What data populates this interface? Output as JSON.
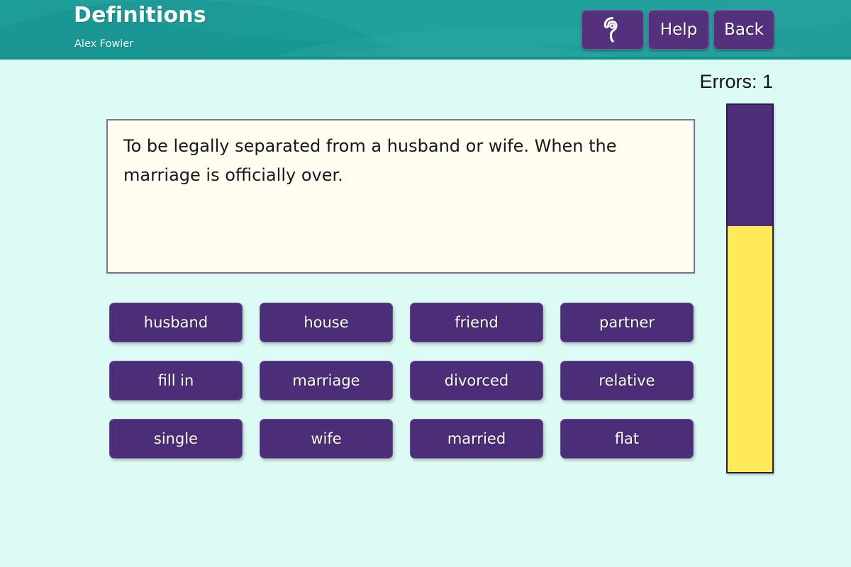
{
  "header": {
    "title": "Definitions",
    "subtitle": "Alex Fowler",
    "buttons": {
      "listen": {
        "icon": "ear-icon",
        "label": ""
      },
      "help": {
        "label": "Help"
      },
      "back": {
        "label": "Back"
      }
    },
    "background_color": "#1d9b97"
  },
  "status": {
    "errors_label": "Errors: 1"
  },
  "progress": {
    "remaining_percent": 33,
    "completed_percent": 67,
    "track_color": "#ffea5c",
    "fill_color": "#4c2d77",
    "border_color": "#2b1b47"
  },
  "definition": {
    "text": "To be legally separated from a husband or wife. When the marriage is officially over.",
    "panel_color": "#fffdf0",
    "border_color": "#7e7391"
  },
  "answers": {
    "button_color": "#4c2d77",
    "rows": [
      [
        {
          "label": "husband"
        },
        {
          "label": "house"
        },
        {
          "label": "friend"
        },
        {
          "label": "partner"
        }
      ],
      [
        {
          "label": "fill in"
        },
        {
          "label": "marriage"
        },
        {
          "label": "divorced"
        },
        {
          "label": "relative"
        }
      ],
      [
        {
          "label": "single"
        },
        {
          "label": "wife"
        },
        {
          "label": "married"
        },
        {
          "label": "flat"
        }
      ]
    ]
  },
  "page": {
    "background_color": "#ddfbf5"
  }
}
